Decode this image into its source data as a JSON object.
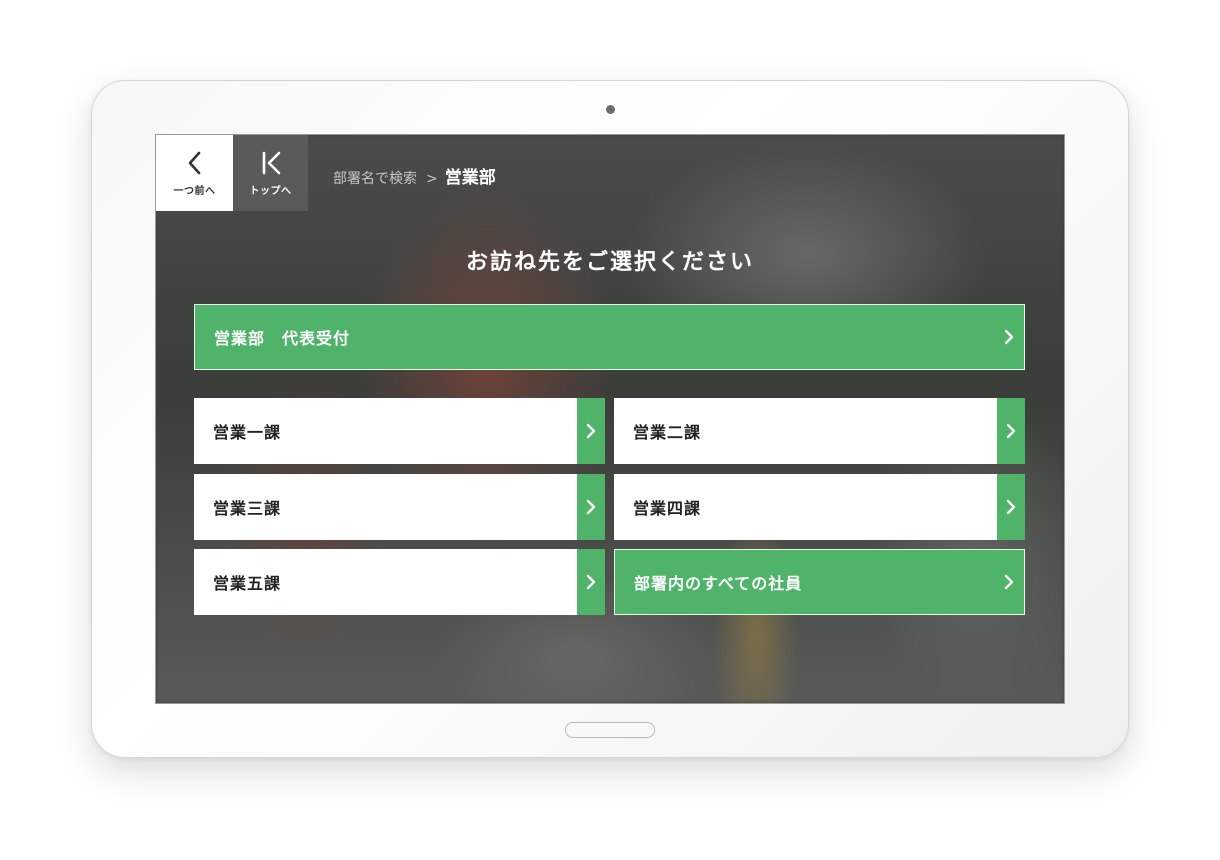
{
  "nav": {
    "back_label": "一つ前へ",
    "top_label": "トップへ"
  },
  "breadcrumb": {
    "parent": "部署名で検索",
    "separator": ">",
    "current": "営業部"
  },
  "heading": "お訪ね先をご選択ください",
  "main_option": "営業部　代表受付",
  "options": [
    "営業一課",
    "営業二課",
    "営業三課",
    "営業四課",
    "営業五課",
    "部署内のすべての社員"
  ],
  "colors": {
    "accent": "#4fb469",
    "top_button": "#5a5a5a"
  },
  "icons": {
    "back": "chevron-left-icon",
    "top": "top-home-icon",
    "option": "chevron-right-icon"
  }
}
